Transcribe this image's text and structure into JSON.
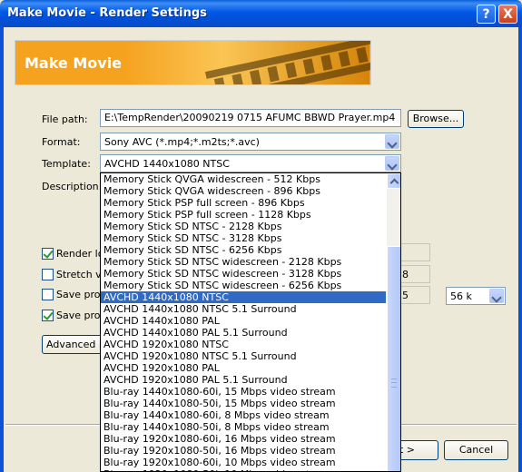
{
  "window": {
    "title": "Make Movie - Render Settings",
    "help_glyph": "?",
    "close_glyph": "X"
  },
  "banner": {
    "title": "Make Movie"
  },
  "form": {
    "file_path_label": "File path:",
    "file_path_value": "E:\\TempRender\\20090219 0715 AFUMC BBWD Prayer.mp4",
    "browse_label": "Browse...",
    "format_label": "Format:",
    "format_value": "Sony AVC (*.mp4;*.m2ts;*.avc)",
    "template_label": "Template:",
    "template_value": "AVCHD 1440x1080 NTSC",
    "description_label": "Description:"
  },
  "options": {
    "render_loop": {
      "label": "Render lo",
      "checked": true
    },
    "stretch_video": {
      "label": "Stretch vi",
      "checked": false
    },
    "save_project_1": {
      "label": "Save proje",
      "checked": false
    },
    "save_project_2": {
      "label": "Save proje",
      "checked": true
    },
    "advanced_label": "Advanced R",
    "partial_value_1": "8",
    "partial_value_2": "5",
    "bitrate_value": "56 k"
  },
  "footer": {
    "next_label": "t >",
    "cancel_label": "Cancel"
  },
  "dropdown": {
    "selected_index": 11,
    "items": [
      "Memory Stick QVGA widescreen - 512 Kbps",
      "Memory Stick QVGA widescreen - 896 Kbps",
      "Memory Stick PSP full screen - 896 Kbps",
      "Memory Stick PSP full screen - 1128 Kbps",
      "Memory Stick SD NTSC - 2128 Kbps",
      "Memory Stick SD NTSC - 3128 Kbps",
      "Memory Stick SD NTSC - 6256 Kbps",
      "Memory Stick SD NTSC widescreen - 2128 Kbps",
      "Memory Stick SD NTSC widescreen - 3128 Kbps",
      "Memory Stick SD NTSC widescreen - 6256 Kbps",
      "AVCHD 1440x1080 NTSC",
      "AVCHD 1440x1080 NTSC",
      "AVCHD 1440x1080 NTSC 5.1 Surround",
      "AVCHD 1440x1080 PAL",
      "AVCHD 1440x1080 PAL 5.1 Surround",
      "AVCHD 1920x1080 NTSC",
      "AVCHD 1920x1080 NTSC 5.1 Surround",
      "AVCHD 1920x1080 PAL",
      "AVCHD 1920x1080 PAL 5.1 Surround",
      "Blu-ray 1440x1080-60i, 15 Mbps video stream",
      "Blu-ray 1440x1080-50i, 15 Mbps video stream",
      "Blu-ray 1440x1080-60i, 8 Mbps video stream",
      "Blu-ray 1440x1080-50i, 8 Mbps video stream",
      "Blu-ray 1920x1080-60i, 16 Mbps video stream",
      "Blu-ray 1920x1080-50i, 16 Mbps video stream",
      "Blu-ray 1920x1080-60i, 10 Mbps video stream",
      "Blu-ray 1920x1080-50i, 10 Mbps video stream"
    ]
  }
}
